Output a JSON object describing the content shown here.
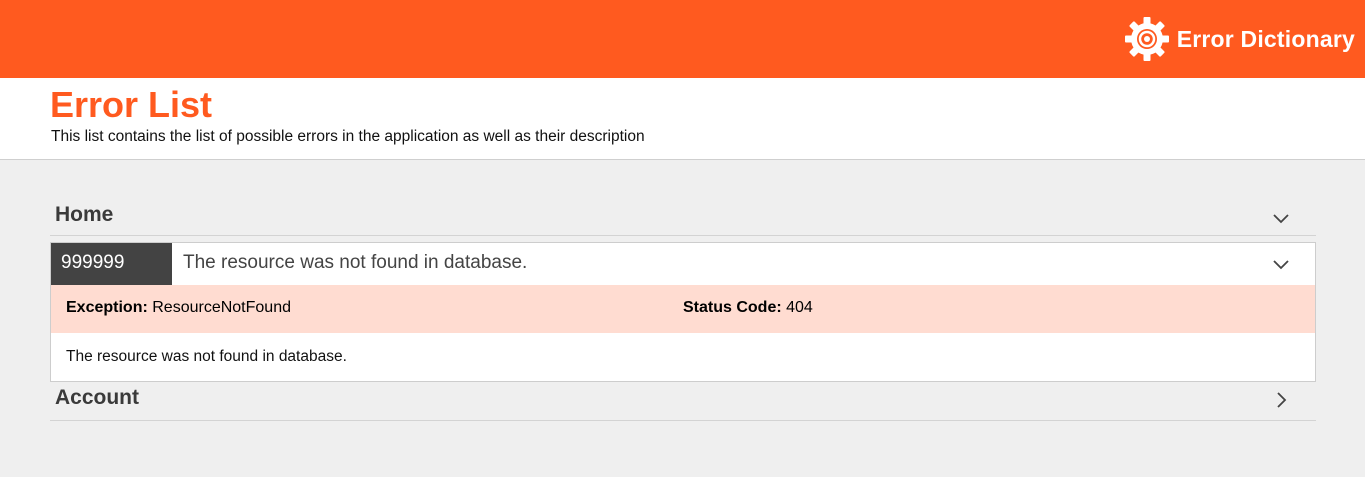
{
  "brand": {
    "title": "Error Dictionary",
    "icon": "gear-icon"
  },
  "header": {
    "title": "Error List",
    "subtitle": "This list contains the list of possible errors in the application as well as their description"
  },
  "colors": {
    "accent": "#ff5a1f",
    "code_bg": "#434343",
    "meta_bg": "#ffdcd1",
    "page_bg": "#efefef"
  },
  "sections": [
    {
      "title": "Home",
      "expanded": true,
      "errors": [
        {
          "code": "999999",
          "message": "The resource was not found in database.",
          "expanded": true,
          "exception_label": "Exception:",
          "exception": "ResourceNotFound",
          "status_label": "Status Code:",
          "status_code": "404",
          "description": "The resource was not found in database."
        }
      ]
    },
    {
      "title": "Account",
      "expanded": false
    }
  ]
}
